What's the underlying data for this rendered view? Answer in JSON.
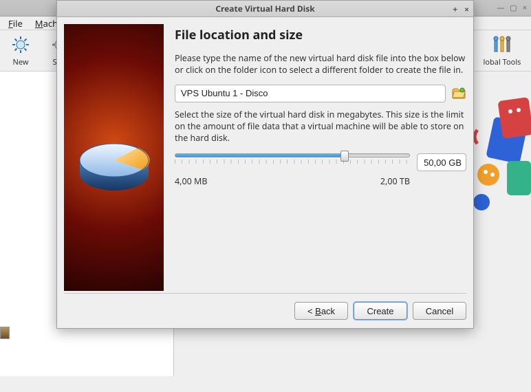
{
  "main_window": {
    "menu": {
      "file": "File",
      "machine": "Machine"
    },
    "toolbar": {
      "new": "New",
      "settings": "Settings",
      "global_tools": "Global Tools"
    },
    "title_controls_tip": "window-controls"
  },
  "dialog": {
    "title": "Create Virtual Hard Disk",
    "heading": "File location and size",
    "desc1": "Please type the name of the new virtual hard disk file into the box below or click on the folder icon to select a different folder to create the file in.",
    "file_value": "VPS Ubuntu 1 - Disco",
    "desc2": "Select the size of the virtual hard disk in megabytes. This size is the limit on the amount of file data that a virtual machine will be able to store on the hard disk.",
    "size_value": "50,00 GB",
    "size_min": "4,00 MB",
    "size_max": "2,00 TB",
    "buttons": {
      "back_prefix": "< ",
      "back_u": "B",
      "back_suffix": "ack",
      "create": "Create",
      "cancel": "Cancel"
    },
    "title_controls": {
      "plus": "+",
      "close": "×"
    }
  }
}
